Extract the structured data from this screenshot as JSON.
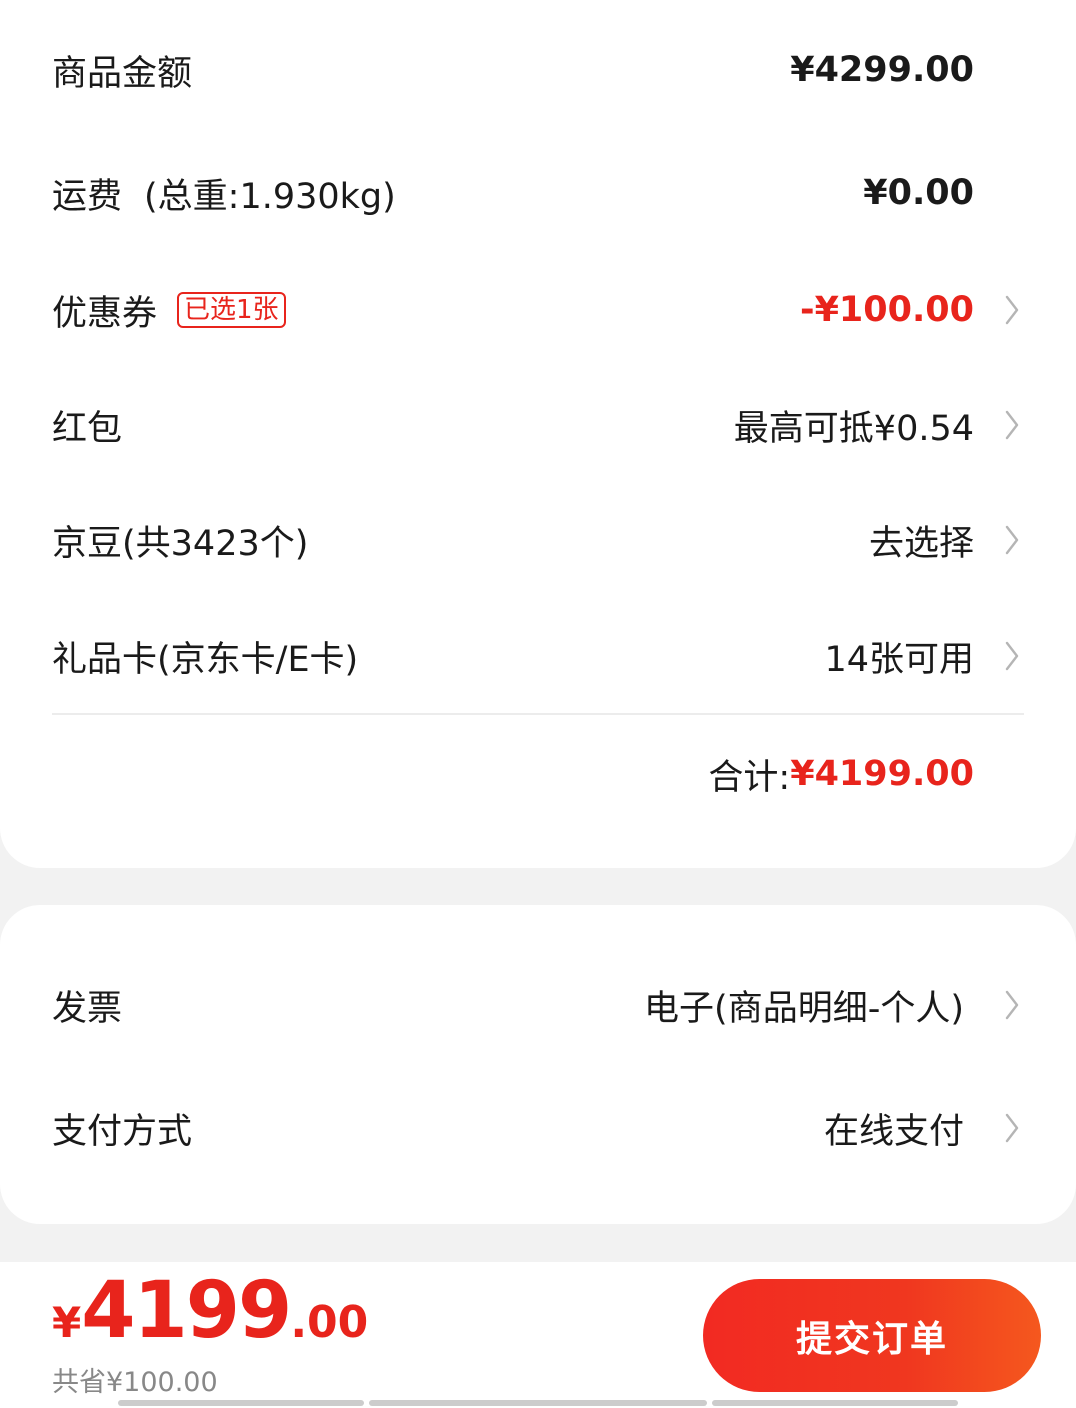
{
  "summary": {
    "goods_amount": {
      "label": "商品金额",
      "value": "¥4299.00"
    },
    "shipping": {
      "label": "运费",
      "weight": "(总重:1.930kg)",
      "value": "¥0.00"
    },
    "coupon": {
      "label": "优惠券",
      "tag": "已选1张",
      "value": "-¥100.00"
    },
    "red_packet": {
      "label": "红包",
      "value": "最高可抵¥0.54"
    },
    "jd_beans": {
      "label": "京豆(共3423个)",
      "value": "去选择"
    },
    "gift_card": {
      "label": "礼品卡(京东卡/E卡)",
      "value": "14张可用"
    },
    "total": {
      "label": "合计:",
      "value": "¥4199.00"
    }
  },
  "options": {
    "invoice": {
      "label": "发票",
      "value": "电子(商品明细-个人)"
    },
    "payment": {
      "label": "支付方式",
      "value": "在线支付"
    }
  },
  "footer": {
    "currency_symbol": "¥",
    "amount_int": "4199",
    "amount_dec": ".00",
    "saved": "共省¥100.00",
    "submit_label": "提交订单"
  },
  "colors": {
    "accent_red": "#e8241c",
    "background": "#f2f2f2"
  }
}
